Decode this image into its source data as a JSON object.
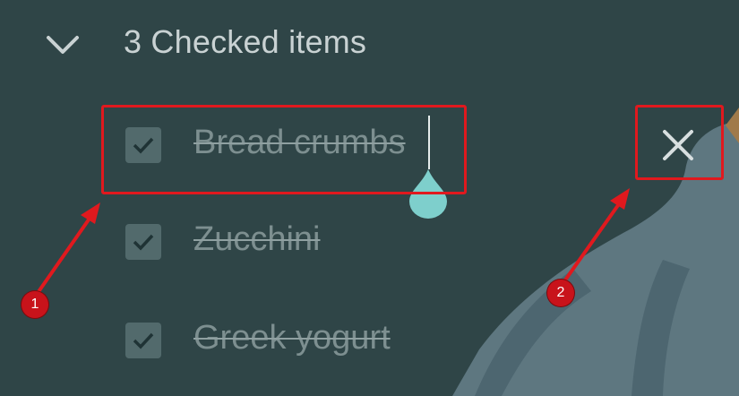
{
  "header": {
    "title": "3 Checked items",
    "chevron_icon": "chevron-down-icon"
  },
  "items": [
    {
      "label": "Bread crumbs",
      "checked": true
    },
    {
      "label": "Zucchini",
      "checked": true
    },
    {
      "label": "Greek yogurt",
      "checked": true
    }
  ],
  "close_icon": "close-icon",
  "annotations": {
    "badge1": "1",
    "badge2": "2"
  },
  "colors": {
    "background": "#2f4547",
    "annotation": "#e0191e",
    "drop_handle": "#7ecfcc"
  }
}
